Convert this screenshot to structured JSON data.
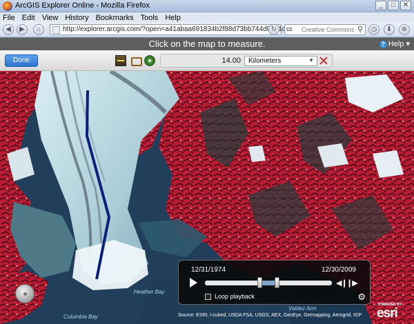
{
  "window": {
    "title": "ArcGIS Explorer Online - Mozilla Firefox",
    "controls": {
      "minimize": "_",
      "maximize": "□",
      "close": "✕"
    }
  },
  "menu": [
    "File",
    "Edit",
    "View",
    "History",
    "Bookmarks",
    "Tools",
    "Help"
  ],
  "navigation": {
    "url": "http://explorer.arcgis.com/?open=a41abaa691834b2f88d73bb744d01d1c",
    "search_engine": "cc",
    "search_placeholder": "Creative Commons"
  },
  "banner": {
    "message": "Click on the map to measure.",
    "help_label": "Help ▾"
  },
  "toolbar": {
    "done_label": "Done",
    "measure_value": "14.00",
    "unit": "Kilometers"
  },
  "map": {
    "labels": {
      "heather_bay": "Heather Bay",
      "columbia_bay": "Columbia Bay",
      "valdez_arm": "Valdez Arm"
    },
    "credits": "Source: ESRI, i-cubed, USDA FSA, USGS, AEX, GeoEye, Getmapping, Aerogrid, IGP",
    "logo_powered": "POWERED BY",
    "logo_word": "esri"
  },
  "time_slider": {
    "start_date": "12/31/1974",
    "end_date": "12/30/2009",
    "range_start_fraction": 0.43,
    "range_end_fraction": 0.57,
    "loop_label": "Loop playback",
    "loop_checked": false
  },
  "colors": {
    "measure_line": "#0a1f7a",
    "vegetation": "#c8203a",
    "glacier": "#c9e6ee",
    "water": "#1f3e5a",
    "banner": "#5e5e5e",
    "done_button": "#3a82dd"
  },
  "icons": [
    "firefox-logo-icon",
    "back-icon",
    "forward-icon",
    "home-icon",
    "favicon-icon",
    "bookmark-star-icon",
    "go-arrow-icon",
    "refresh-icon",
    "search-icon",
    "history-icon",
    "download-icon",
    "zoom-icon",
    "help-icon",
    "measure-distance-icon",
    "measure-area-icon",
    "location-icon",
    "clear-measure-icon",
    "play-icon",
    "step-back-icon",
    "step-forward-icon",
    "gear-icon"
  ]
}
